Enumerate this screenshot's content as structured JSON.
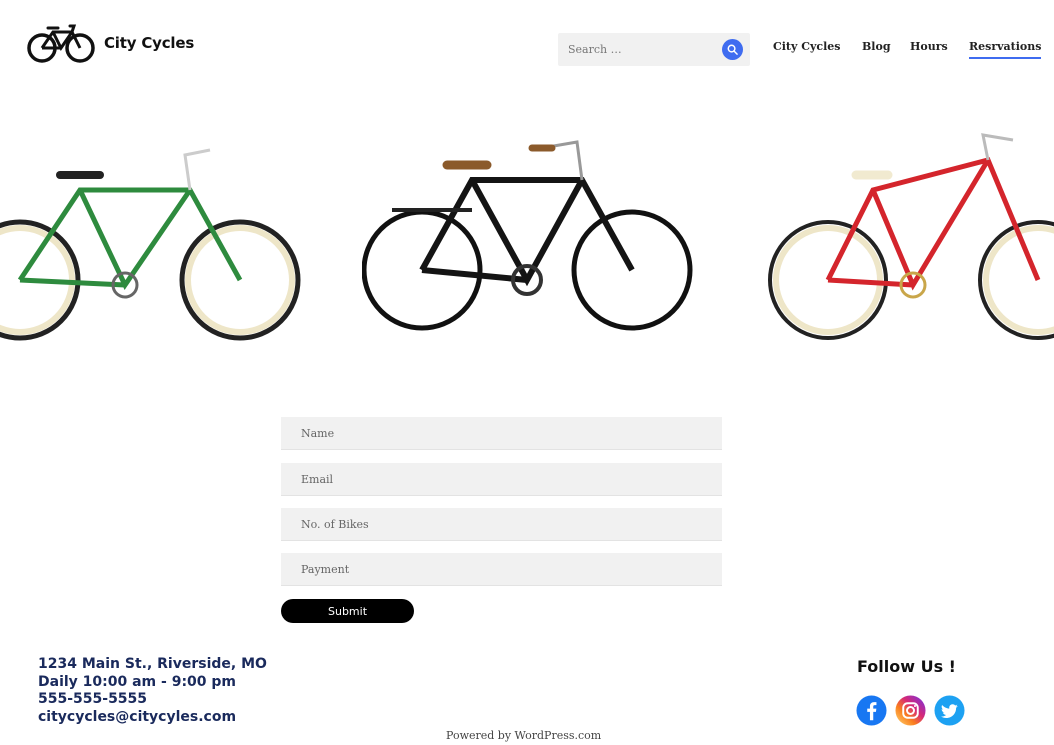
{
  "site": {
    "brand": "City Cycles"
  },
  "search": {
    "placeholder": "Search …"
  },
  "nav": {
    "items": [
      "City Cycles",
      "Blog",
      "Hours",
      "Resrvations"
    ],
    "active": "Resrvations"
  },
  "bikes": [
    {
      "name": "green-bike",
      "frame_color": "#2e8b3e"
    },
    {
      "name": "black-bike",
      "frame_color": "#141414"
    },
    {
      "name": "red-bike",
      "frame_color": "#d4252c"
    }
  ],
  "form": {
    "name_placeholder": "Name",
    "email_placeholder": "Email",
    "bikes_placeholder": "No. of Bikes",
    "payment_placeholder": "Payment",
    "submit_label": "Submit"
  },
  "footer": {
    "address": "1234 Main St., Riverside, MO",
    "hours": "Daily 10:00 am - 9:00 pm",
    "phone": "555-555-5555",
    "email": "citycycles@citycyles.com",
    "follow_label": "Follow Us !",
    "social": [
      "facebook-icon",
      "instagram-icon",
      "twitter-icon"
    ],
    "powered_by": "Powered by WordPress.com"
  },
  "colors": {
    "accent": "#3f6cf0",
    "footer_text": "#1a2a5c",
    "facebook": "#1877f2",
    "twitter": "#1da1f2"
  }
}
